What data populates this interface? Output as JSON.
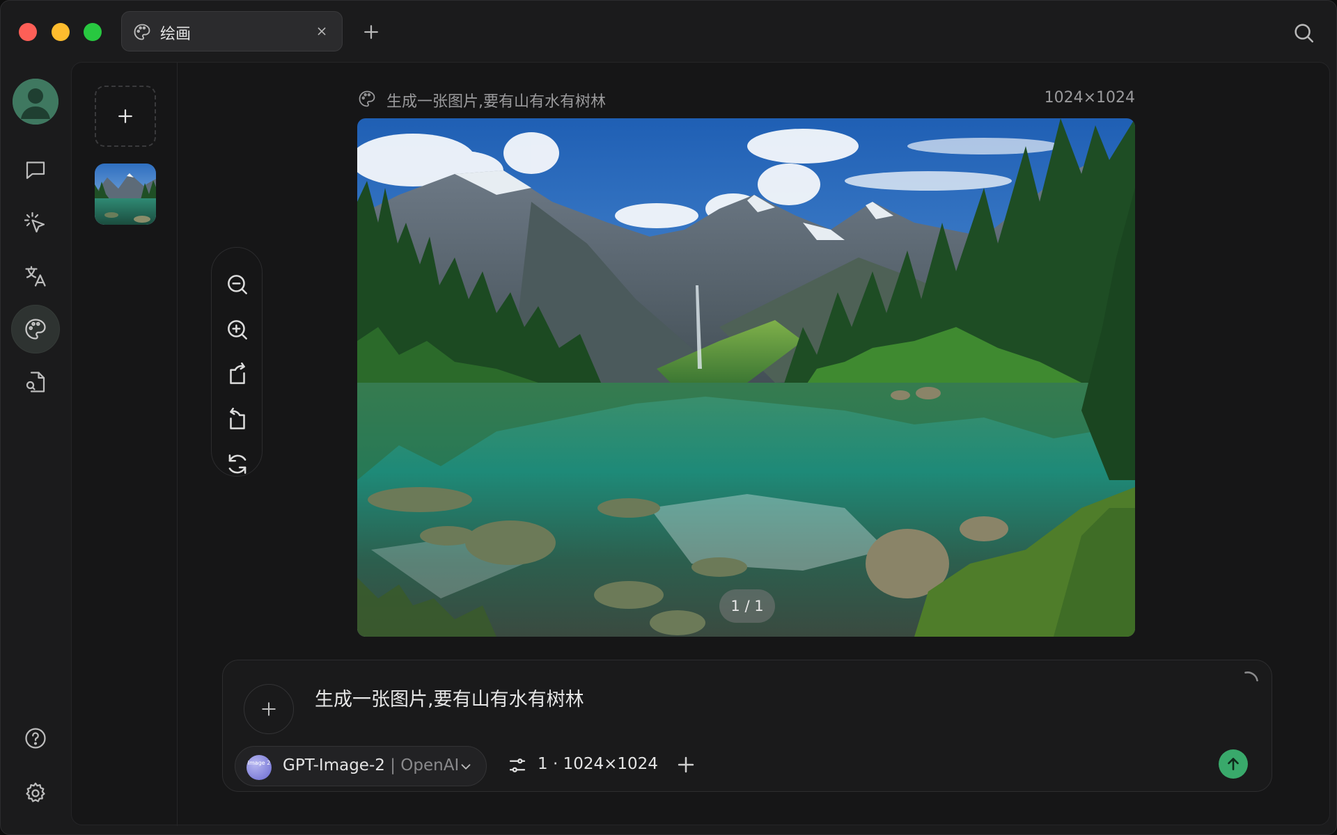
{
  "tab": {
    "label": "绘画"
  },
  "prompt_header": {
    "text": "生成一张图片,要有山有水有树林",
    "size": "1024×1024"
  },
  "image": {
    "pager": "1 / 1"
  },
  "composer": {
    "text": "生成一张图片,要有山有水有树林",
    "model_badge": "Image 2",
    "model_name": "GPT-Image-2",
    "model_sep": " | ",
    "model_provider": "OpenAI",
    "settings": "1 · 1024×1024"
  },
  "colors": {
    "accent": "#39a96b",
    "close": "#fe5f57",
    "minimize": "#febc2e",
    "maximize": "#28c840"
  }
}
